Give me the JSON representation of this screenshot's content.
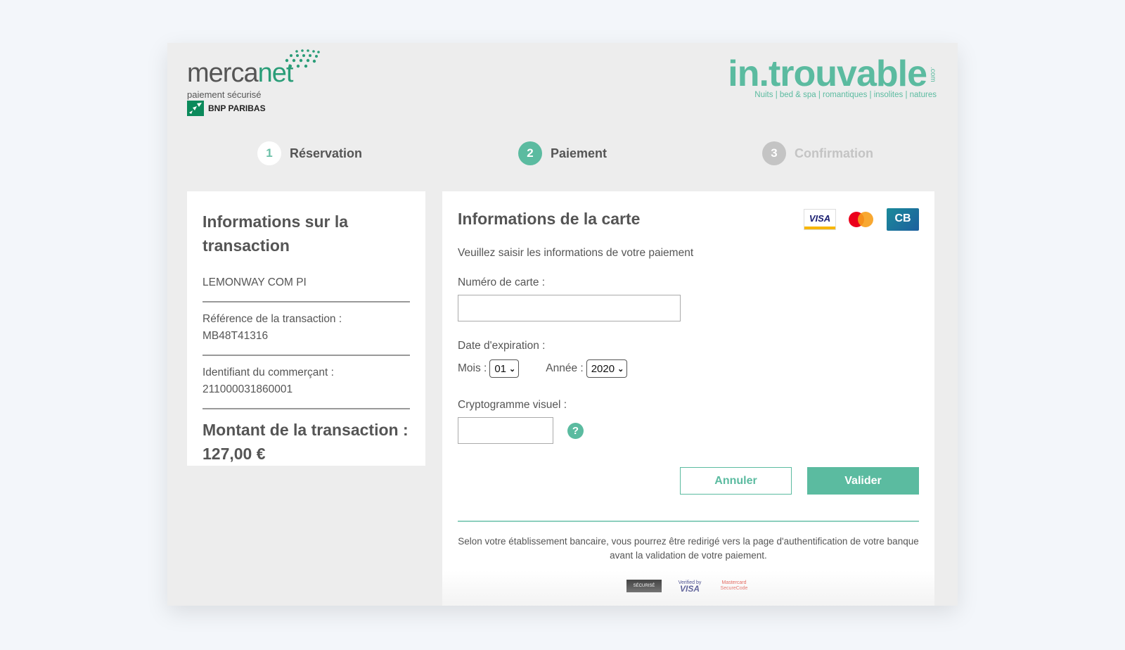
{
  "header": {
    "mercanet_logo": {
      "word_a": "merca",
      "word_b": "net",
      "tagline": "paiement sécurisé",
      "bank": "BNP PARIBAS"
    },
    "merchant_logo": {
      "word": "in.trouvable",
      "suffix": ".com",
      "tagline": "Nuits | bed & spa | romantiques | insolites | natures"
    }
  },
  "steps": [
    {
      "number": "1",
      "label": "Réservation",
      "state": "done"
    },
    {
      "number": "2",
      "label": "Paiement",
      "state": "active"
    },
    {
      "number": "3",
      "label": "Confirmation",
      "state": "pending"
    }
  ],
  "transaction": {
    "title": "Informations sur la transaction",
    "merchant_name": "LEMONWAY COM PI",
    "reference_label": "Référence de la transaction :",
    "reference_value": "MB48T41316",
    "merchant_id_label": "Identifiant du commerçant :",
    "merchant_id_value": "211000031860001",
    "amount_label": "Montant de la transaction :",
    "amount_value": "127,00 €"
  },
  "card_form": {
    "title": "Informations de la carte",
    "card_icons": [
      "visa-icon",
      "mastercard-icon",
      "cb-icon"
    ],
    "visa_text": "VISA",
    "cb_text": "CB",
    "subtitle": "Veuillez saisir les informations de votre paiement",
    "card_number_label": "Numéro de carte :",
    "card_number_value": "",
    "expiry_label": "Date d'expiration :",
    "month_label": "Mois :",
    "month_value": "01",
    "year_label": "Année :",
    "year_value": "2020",
    "cvv_label": "Cryptogramme visuel :",
    "cvv_value": "",
    "help_text": "?",
    "cancel_label": "Annuler",
    "submit_label": "Valider",
    "notice": "Selon votre établissement bancaire, vous pourrez être redirigé vers la page d'authentification de votre banque avant la validation de votre paiement."
  },
  "footer_logos": {
    "secure_text": "SÉCURISÉ",
    "vbv_small": "Verified by",
    "vbv_big": "VISA",
    "mc_line1": "Mastercard",
    "mc_line2": "SecureCode"
  },
  "colors": {
    "accent": "#5bbba0",
    "pending": "#c4c4c4",
    "text": "#555555",
    "background": "#f3f6fa",
    "frame": "#ededed"
  }
}
